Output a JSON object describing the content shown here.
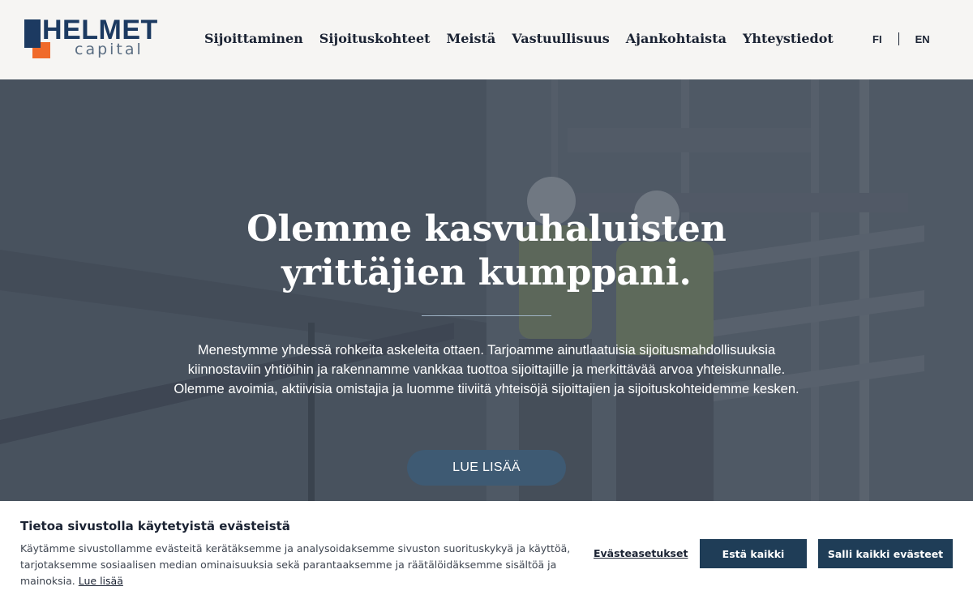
{
  "brand": {
    "name": "HELMET",
    "sub": "capital",
    "colors": {
      "navy": "#1c3a61",
      "orange": "#f06a2a"
    }
  },
  "nav": {
    "items": [
      "Sijoittaminen",
      "Sijoituskohteet",
      "Meistä",
      "Vastuullisuus",
      "Ajankohtaista",
      "Yhteystiedot"
    ]
  },
  "lang": {
    "fi": "FI",
    "en": "EN"
  },
  "hero": {
    "title": "Olemme kasvuhaluisten yrittäjien kumppani.",
    "body": "Menestymme yhdessä rohkeita askeleita ottaen. Tarjoamme ainutlaatuisia sijoitusmahdollisuuksia kiinnostaviin yhtiöihin ja rakennamme vankkaa tuottoa sijoittajille ja merkittävää arvoa yhteiskunnalle. Olemme avoimia, aktiivisia omistajia ja luomme tiiviitä yhteisöjä sijoittajien ja sijoituskohteidemme kesken.",
    "cta": "LUE LISÄÄ"
  },
  "cookie": {
    "title": "Tietoa sivustolla käytetyistä evästeistä",
    "text": "Käytämme sivustollamme evästeitä kerätäksemme ja analysoidaksemme sivuston suorituskykyä ja käyttöä, tarjotaksemme sosiaalisen median ominaisuuksia sekä parantaaksemme ja räätälöidäksemme sisältöä ja mainoksia.",
    "more": "Lue lisää",
    "settings": "Evästeasetukset",
    "deny": "Estä kaikki",
    "allow": "Salli kaikki evästeet"
  }
}
